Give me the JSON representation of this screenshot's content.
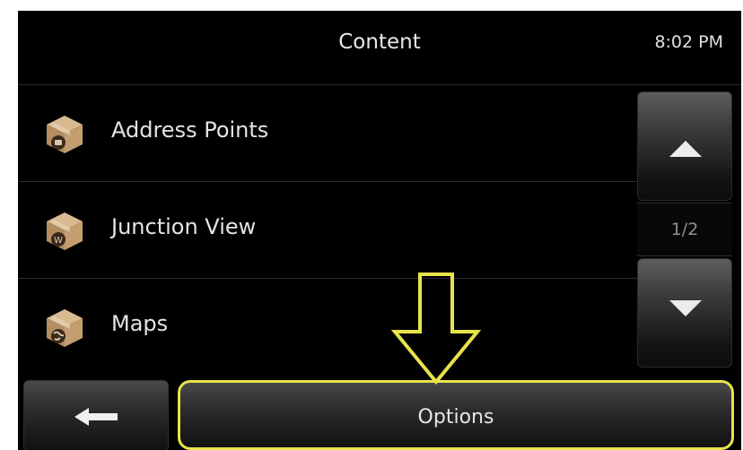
{
  "header": {
    "title": "Content",
    "clock": "8:02 PM"
  },
  "list": {
    "items": [
      {
        "label": "Address Points",
        "icon": "package-address-icon"
      },
      {
        "label": "Junction View",
        "icon": "package-junction-icon"
      },
      {
        "label": "Maps",
        "icon": "package-globe-icon"
      }
    ]
  },
  "pager": {
    "text": "1/2"
  },
  "bottom": {
    "options_label": "Options",
    "back_icon": "back-arrow-icon"
  },
  "colors": {
    "highlight": "#e7e34a",
    "background": "#000000",
    "text": "#e4e4e4"
  }
}
